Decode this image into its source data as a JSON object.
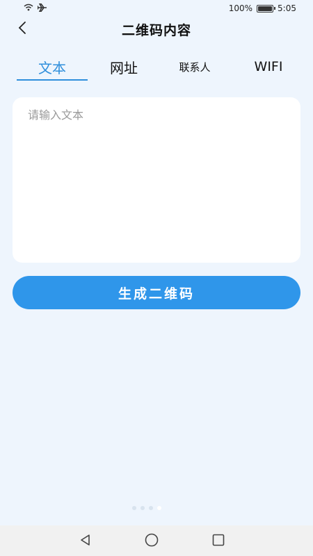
{
  "status_bar": {
    "battery_text": "100%",
    "time": "5:05",
    "icons": [
      "wifi-icon",
      "airplane-icon",
      "battery-icon"
    ]
  },
  "header": {
    "title": "二维码内容",
    "back_icon": "chevron-left-icon"
  },
  "tabs": [
    {
      "label": "文本",
      "active": true
    },
    {
      "label": "网址",
      "active": false
    },
    {
      "label": "联系人",
      "active": false
    },
    {
      "label": "WIFI",
      "active": false
    }
  ],
  "text_input": {
    "placeholder": "请输入文本",
    "value": ""
  },
  "generate_button": {
    "label": "生成二维码"
  },
  "page_indicator": {
    "count": 4,
    "active_index": 3
  },
  "nav_bar": {
    "icons": [
      "back-triangle-icon",
      "home-circle-icon",
      "recents-square-icon"
    ]
  },
  "colors": {
    "accent": "#2f8fdc",
    "button": "#2f96ea",
    "background": "#eef5fd",
    "card": "#ffffff"
  }
}
